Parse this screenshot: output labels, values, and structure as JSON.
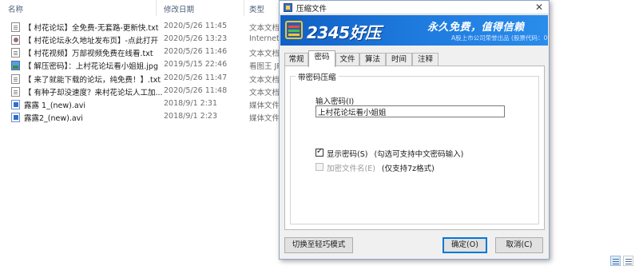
{
  "explorer": {
    "headers": {
      "name": "名称",
      "date": "修改日期",
      "type": "类型"
    },
    "files": [
      {
        "name": "【 村花论坛】全免费-无套路-更新快.txt",
        "date": "2020/5/26 11:45",
        "type": "文本文档",
        "icon": "text-file-icon"
      },
      {
        "name": "【 村花论坛永久地址发布页】-点此打开",
        "date": "2020/5/26 13:23",
        "type": "Internet",
        "icon": "internet-shortcut-icon"
      },
      {
        "name": "【 村花视频】万部视频免费在线看.txt",
        "date": "2020/5/26 11:46",
        "type": "文本文档",
        "icon": "text-file-icon"
      },
      {
        "name": "【 解压密码】：上村花论坛看小姐姐.jpg",
        "date": "2019/5/15 22:46",
        "type": "看图王 JP",
        "icon": "image-file-icon"
      },
      {
        "name": "【 来了就能下载的论坛，纯免费！】.txt",
        "date": "2020/5/26 11:47",
        "type": "文本文档",
        "icon": "text-file-icon"
      },
      {
        "name": "【 有种子却没速度？来村花论坛人工加...",
        "date": "2020/5/26 11:48",
        "type": "文本文档",
        "icon": "text-file-icon"
      },
      {
        "name": "露露 1_(new).avi",
        "date": "2018/9/1 2:31",
        "type": "媒体文件",
        "icon": "video-file-icon"
      },
      {
        "name": "露露2_(new).avi",
        "date": "2018/9/1 2:23",
        "type": "媒体文件",
        "icon": "video-file-icon"
      }
    ]
  },
  "dialog": {
    "title": "压缩文件",
    "banner": {
      "brand": "2345好压",
      "slogan": "永久免费，值得信赖",
      "sub": "A股上市公司荣誉出品 (股票代码：002195)"
    },
    "tabs": [
      {
        "label": "常规",
        "active": false
      },
      {
        "label": "密码",
        "active": true
      },
      {
        "label": "文件",
        "active": false
      },
      {
        "label": "算法",
        "active": false
      },
      {
        "label": "时间",
        "active": false
      },
      {
        "label": "注释",
        "active": false
      }
    ],
    "group_title": "带密码压缩",
    "password_label": "输入密码(I)",
    "password_value": "上村花论坛看小姐姐",
    "show_password": {
      "label": "显示密码(S)",
      "hint": "(勾选可支持中文密码输入)",
      "checked": true
    },
    "encrypt_names": {
      "label": "加密文件名(E)",
      "hint": "(仅支持7z格式)",
      "checked": false,
      "disabled": true
    },
    "buttons": {
      "light_mode": "切换至轻巧模式",
      "ok": "确定(O)",
      "cancel": "取消(C)"
    }
  }
}
